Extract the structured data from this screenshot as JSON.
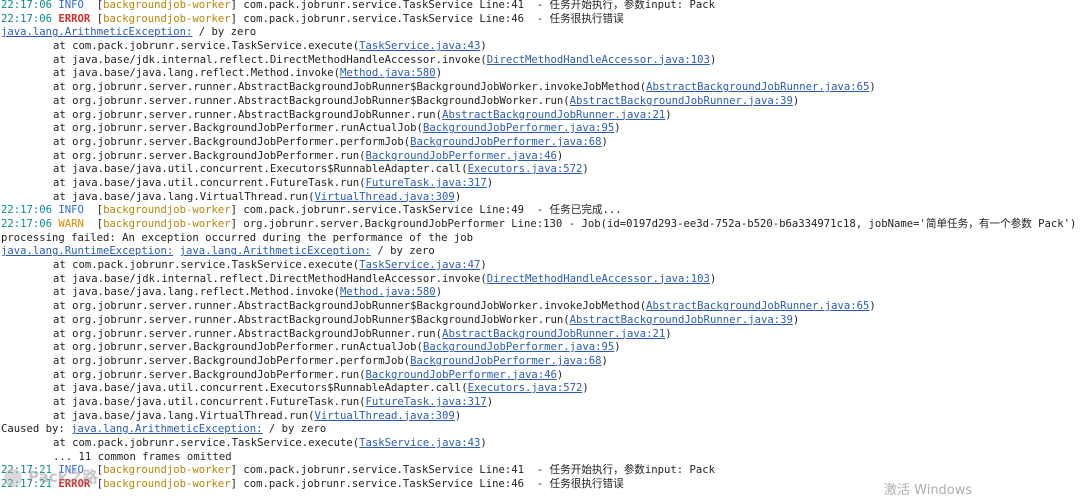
{
  "logs": {
    "l1": {
      "ts": "22:17:06",
      "level": "INFO ",
      "thread": "backgroundjob-worker",
      "msg": " com.pack.jobrunr.service.TaskService Line:41  - 任务开始执行，参数input: Pack"
    },
    "l2": {
      "ts": "22:17:06",
      "level": "ERROR",
      "thread": "backgroundjob-worker",
      "msg": " com.pack.jobrunr.service.TaskService Line:46  - 任务很执行错误"
    },
    "l3": {
      "exc": "java.lang.ArithmeticException:",
      "rest": " / by zero"
    },
    "l4": {
      "pre": "at com.pack.jobrunr.service.TaskService.execute(",
      "link": "TaskService.java:43",
      "post": ")"
    },
    "l5": {
      "pre": "at java.base/jdk.internal.reflect.DirectMethodHandleAccessor.invoke(",
      "link": "DirectMethodHandleAccessor.java:103",
      "post": ")"
    },
    "l6": {
      "pre": "at java.base/java.lang.reflect.Method.invoke(",
      "link": "Method.java:580",
      "post": ")"
    },
    "l7": {
      "pre": "at org.jobrunr.server.runner.AbstractBackgroundJobRunner$BackgroundJobWorker.invokeJobMethod(",
      "link": "AbstractBackgroundJobRunner.java:65",
      "post": ")"
    },
    "l8": {
      "pre": "at org.jobrunr.server.runner.AbstractBackgroundJobRunner$BackgroundJobWorker.run(",
      "link": "AbstractBackgroundJobRunner.java:39",
      "post": ")"
    },
    "l9": {
      "pre": "at org.jobrunr.server.runner.AbstractBackgroundJobRunner.run(",
      "link": "AbstractBackgroundJobRunner.java:21",
      "post": ")"
    },
    "l10": {
      "pre": "at org.jobrunr.server.BackgroundJobPerformer.runActualJob(",
      "link": "BackgroundJobPerformer.java:95",
      "post": ")"
    },
    "l11": {
      "pre": "at org.jobrunr.server.BackgroundJobPerformer.performJob(",
      "link": "BackgroundJobPerformer.java:68",
      "post": ")"
    },
    "l12": {
      "pre": "at org.jobrunr.server.BackgroundJobPerformer.run(",
      "link": "BackgroundJobPerformer.java:46",
      "post": ")"
    },
    "l13": {
      "pre": "at java.base/java.util.concurrent.Executors$RunnableAdapter.call(",
      "link": "Executors.java:572",
      "post": ")"
    },
    "l14": {
      "pre": "at java.base/java.util.concurrent.FutureTask.run(",
      "link": "FutureTask.java:317",
      "post": ")"
    },
    "l15": {
      "pre": "at java.base/java.lang.VirtualThread.run(",
      "link": "VirtualThread.java:309",
      "post": ")"
    },
    "l16": {
      "ts": "22:17:06",
      "level": "INFO ",
      "thread": "backgroundjob-worker",
      "msg": " com.pack.jobrunr.service.TaskService Line:49  - 任务已完成..."
    },
    "l17": {
      "ts": "22:17:06",
      "level": "WARN ",
      "thread": "backgroundjob-worker",
      "msg": " org.jobrunr.server.BackgroundJobPerformer Line:130 - Job(id=0197d293-ee3d-752a-b520-b6a334971c18, jobName='简单任务，有一个参数 Pack')"
    },
    "l18": {
      "text": "processing failed: An exception occurred during the performance of the job"
    },
    "l19": {
      "exc1": "java.lang.RuntimeException:",
      "exc2": "java.lang.ArithmeticException:",
      "rest": " / by zero"
    },
    "l20": {
      "pre": "at com.pack.jobrunr.service.TaskService.execute(",
      "link": "TaskService.java:47",
      "post": ")"
    },
    "l21": {
      "pre": "at java.base/jdk.internal.reflect.DirectMethodHandleAccessor.invoke(",
      "link": "DirectMethodHandleAccessor.java:103",
      "post": ")"
    },
    "l22": {
      "pre": "at java.base/java.lang.reflect.Method.invoke(",
      "link": "Method.java:580",
      "post": ")"
    },
    "l23": {
      "pre": "at org.jobrunr.server.runner.AbstractBackgroundJobRunner$BackgroundJobWorker.invokeJobMethod(",
      "link": "AbstractBackgroundJobRunner.java:65",
      "post": ")"
    },
    "l24": {
      "pre": "at org.jobrunr.server.runner.AbstractBackgroundJobRunner$BackgroundJobWorker.run(",
      "link": "AbstractBackgroundJobRunner.java:39",
      "post": ")"
    },
    "l25": {
      "pre": "at org.jobrunr.server.runner.AbstractBackgroundJobRunner.run(",
      "link": "AbstractBackgroundJobRunner.java:21",
      "post": ")"
    },
    "l26": {
      "pre": "at org.jobrunr.server.BackgroundJobPerformer.runActualJob(",
      "link": "BackgroundJobPerformer.java:95",
      "post": ")"
    },
    "l27": {
      "pre": "at org.jobrunr.server.BackgroundJobPerformer.performJob(",
      "link": "BackgroundJobPerformer.java:68",
      "post": ")"
    },
    "l28": {
      "pre": "at org.jobrunr.server.BackgroundJobPerformer.run(",
      "link": "BackgroundJobPerformer.java:46",
      "post": ")"
    },
    "l29": {
      "pre": "at java.base/java.util.concurrent.Executors$RunnableAdapter.call(",
      "link": "Executors.java:572",
      "post": ")"
    },
    "l30": {
      "pre": "at java.base/java.util.concurrent.FutureTask.run(",
      "link": "FutureTask.java:317",
      "post": ")"
    },
    "l31": {
      "pre": "at java.base/java.lang.VirtualThread.run(",
      "link": "VirtualThread.java:309",
      "post": ")"
    },
    "l32": {
      "pre": "Caused by: ",
      "exc": "java.lang.ArithmeticException:",
      "rest": " / by zero"
    },
    "l33": {
      "pre": "at com.pack.jobrunr.service.TaskService.execute(",
      "link": "TaskService.java:43",
      "post": ")"
    },
    "l34": {
      "text": "... 11 common frames omitted"
    },
    "l35": {
      "ts": "22:17:21",
      "level": "INFO ",
      "thread": "backgroundjob-worker",
      "msg": " com.pack.jobrunr.service.TaskService Line:41  - 任务开始执行，参数input: Pack"
    },
    "l36": {
      "ts": "22:17:21",
      "level": "ERROR",
      "thread": "backgroundjob-worker",
      "msg": " com.pack.jobrunr.service.TaskService Line:46  - 任务很执行错误"
    }
  },
  "watermark": {
    "text": "Pack之路"
  },
  "activate": {
    "text": "激活 Windows"
  },
  "colors": {
    "timestamp": "#0b8a8a",
    "info": "#2f6bd6",
    "error": "#d32f2f",
    "warn": "#d88a00",
    "thread": "#b8860b",
    "link": "#2a5db0"
  }
}
